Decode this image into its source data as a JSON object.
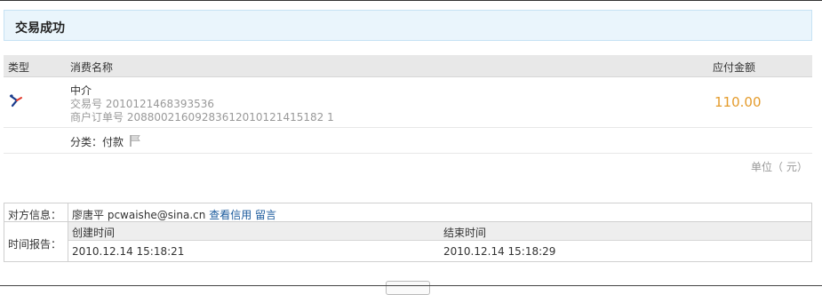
{
  "page_title": "交易成功",
  "table": {
    "col_type": "类型",
    "col_name": "消费名称",
    "col_amount": "应付金额"
  },
  "item": {
    "icon": "bird-icon",
    "name": "中介",
    "trade_no_label": "交易号",
    "trade_no": "2010121468393536",
    "order_no_label": "商户订单号",
    "order_no": "20880021609283612010121415182 1",
    "amount": "110.00",
    "category_label": "分类：",
    "category_value": "付款",
    "flag_icon": "flag-icon"
  },
  "unit_note": "单位（ 元）",
  "counterparty": {
    "label": "对方信息：",
    "name": "廖唐平",
    "email": "pcwaishe@sina.cn",
    "credit_link": "查看信用",
    "message_link": "留言"
  },
  "time_report": {
    "label": "时间报告：",
    "created_label": "创建时间",
    "ended_label": "结束时间",
    "created": "2010.12.14 15:18:21",
    "ended": "2010.12.14 15:18:29"
  },
  "colors": {
    "amount": "#e49b2c",
    "link": "#1a5a9c",
    "title_bg": "#eaf5fc"
  }
}
